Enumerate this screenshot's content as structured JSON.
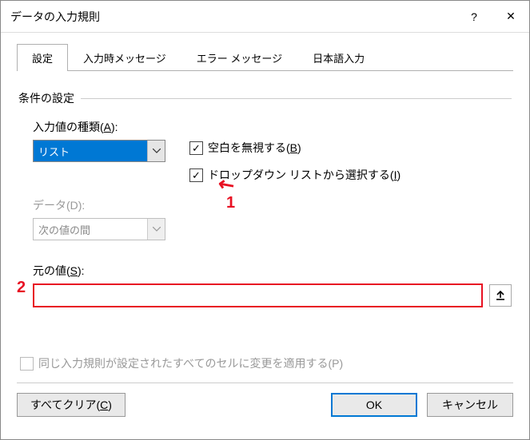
{
  "window": {
    "title": "データの入力規則",
    "help": "?",
    "close": "✕"
  },
  "tabs": {
    "t0": "設定",
    "t1": "入力時メッセージ",
    "t2": "エラー メッセージ",
    "t3": "日本語入力"
  },
  "section": {
    "legend": "条件の設定",
    "allow_label_pre": "入力値の種類(",
    "allow_label_u": "A",
    "allow_label_post": "):",
    "allow_value": "リスト",
    "data_label": "データ(D):",
    "data_value": "次の値の間",
    "source_label_pre": "元の値(",
    "source_label_u": "S",
    "source_label_post": "):",
    "source_value": ""
  },
  "checks": {
    "ignore_blank_pre": "空白を無視する(",
    "ignore_blank_u": "B",
    "ignore_blank_post": ")",
    "dropdown_pre": "ドロップダウン リストから選択する(",
    "dropdown_u": "I",
    "dropdown_post": ")"
  },
  "apply": {
    "label": "同じ入力規則が設定されたすべてのセルに変更を適用する(P)"
  },
  "buttons": {
    "clear_pre": "すべてクリア(",
    "clear_u": "C",
    "clear_post": ")",
    "ok": "OK",
    "cancel": "キャンセル"
  },
  "annotations": {
    "a1": "1",
    "a2": "2"
  }
}
